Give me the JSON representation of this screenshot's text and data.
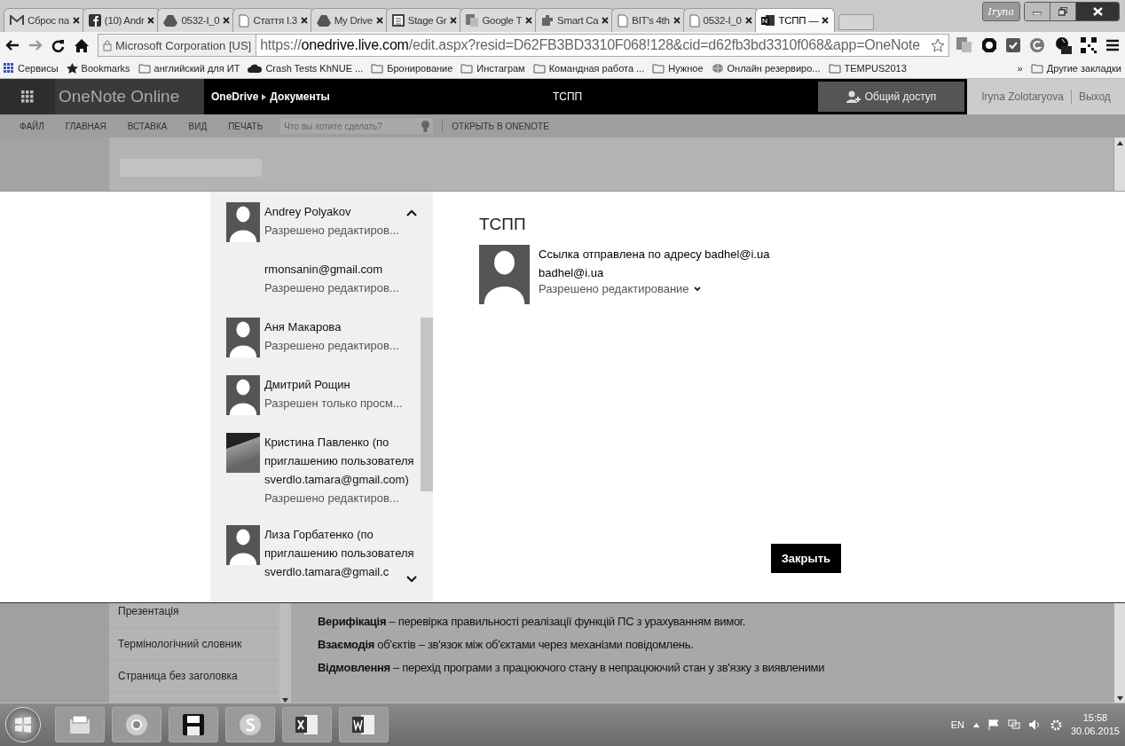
{
  "browser": {
    "tabs": [
      {
        "title": "Сброс па",
        "kind": "mail",
        "selected": false
      },
      {
        "title": "(10) Andr",
        "kind": "facebook",
        "selected": false
      },
      {
        "title": "0532-I_0",
        "kind": "drive",
        "selected": false
      },
      {
        "title": "Стаття I.3",
        "kind": "doc",
        "selected": false
      },
      {
        "title": "My Drive",
        "kind": "drive",
        "selected": false
      },
      {
        "title": "Stage Gr",
        "kind": "sheet",
        "selected": false
      },
      {
        "title": "Google T",
        "kind": "translate",
        "selected": false
      },
      {
        "title": "Smart Ca",
        "kind": "puzzle",
        "selected": false
      },
      {
        "title": "BIT's 4th",
        "kind": "doc",
        "selected": false
      },
      {
        "title": "0532-I_0",
        "kind": "doc",
        "selected": false
      },
      {
        "title": "ТСПП —",
        "kind": "onenote",
        "selected": true
      }
    ],
    "profile": "Iryna",
    "certificate": "Microsoft Corporation [US]",
    "url": "https://**onedrive.live.com**/edit.aspx?resid=D62FB3BD3310F068!128&cid=d62fb3bd3310f068&app=OneNote",
    "bookmarks": [
      {
        "label": "Сервисы",
        "kind": "apps"
      },
      {
        "label": "Bookmarks",
        "kind": "star"
      },
      {
        "label": "английский для ИТ",
        "kind": "folder"
      },
      {
        "label": "Crash Tests KhNUE ...",
        "kind": "cloud"
      },
      {
        "label": "Бронирование",
        "kind": "folder"
      },
      {
        "label": "Инстаграм",
        "kind": "folder"
      },
      {
        "label": "Командная работа ...",
        "kind": "folder"
      },
      {
        "label": "Нужное",
        "kind": "folder"
      },
      {
        "label": "Онлайн резервиро...",
        "kind": "globe"
      },
      {
        "label": "TEMPUS2013",
        "kind": "folder"
      }
    ],
    "more": "»",
    "other_bookmarks": "Другие закладки"
  },
  "app": {
    "name": "OneNote Online",
    "breadcrumb": [
      "OneDrive",
      "Документы"
    ],
    "title": "ТСПП",
    "share": "Общий доступ",
    "user": "Iryna Zolotaryova",
    "sign_out": "Выход"
  },
  "ribbon": {
    "tabs": [
      "ФАЙЛ",
      "ГЛАВНАЯ",
      "ВСТАВКА",
      "ВИД",
      "ПЕЧАТЬ"
    ],
    "search": {
      "placeholder": "Что вы хотите сделать?"
    },
    "open_in": "ОТКРЫТЬ В ONENOTE"
  },
  "dialog": {
    "people": [
      {
        "name": "Andrey Polyakov",
        "permission": "Разрешено редактиров...",
        "kind": "silhouette"
      },
      {
        "name": "rmonsanin@gmail.com",
        "permission": "Разрешено редактиров...",
        "kind": "none"
      },
      {
        "name": "Аня Макарова",
        "permission": "Разрешено редактиров...",
        "kind": "silhouette"
      },
      {
        "name": "Дмитрий Рощин",
        "permission": "Разрешен только просм...",
        "kind": "silhouette"
      },
      {
        "name": "Кристина Павленко (по приглашению пользователя sverdlo.tamara@gmail.com)",
        "permission": "Разрешено редактиров...",
        "kind": "photo"
      },
      {
        "name": "Лиза Горбатенко (по приглашению пользователя sverdlo.tamara@gmail.c",
        "kind": "silhouette"
      }
    ],
    "title": "ТСПП",
    "message": "Ссылка отправлена по адресу badhel@i.ua",
    "recipient": "badhel@i.ua",
    "permission": "Разрешено редактирование",
    "close": "Закрыть"
  },
  "notebook": {
    "sections": [
      "Презентація",
      "Термінологічний словник",
      "Страница без заголовка"
    ],
    "paragraphs": [
      "**Верифікація** – перевірка правильності реалізації функцій ПС з урахуванням вимог.",
      "**Взаємодія** об'єктів – зв'язок між об'єктами через механізми повідомлень.",
      "**Відмовлення** – перехід програми з працюючого стану в непрацюючий стан у зв'язку з виявленими"
    ]
  },
  "taskbar": {
    "apps": [
      {
        "kind": "files"
      },
      {
        "kind": "chrome"
      },
      {
        "kind": "save"
      },
      {
        "kind": "skype"
      },
      {
        "kind": "excel"
      },
      {
        "kind": "word"
      }
    ],
    "language": "EN",
    "time": "15:58",
    "date": "30.06.2015"
  }
}
